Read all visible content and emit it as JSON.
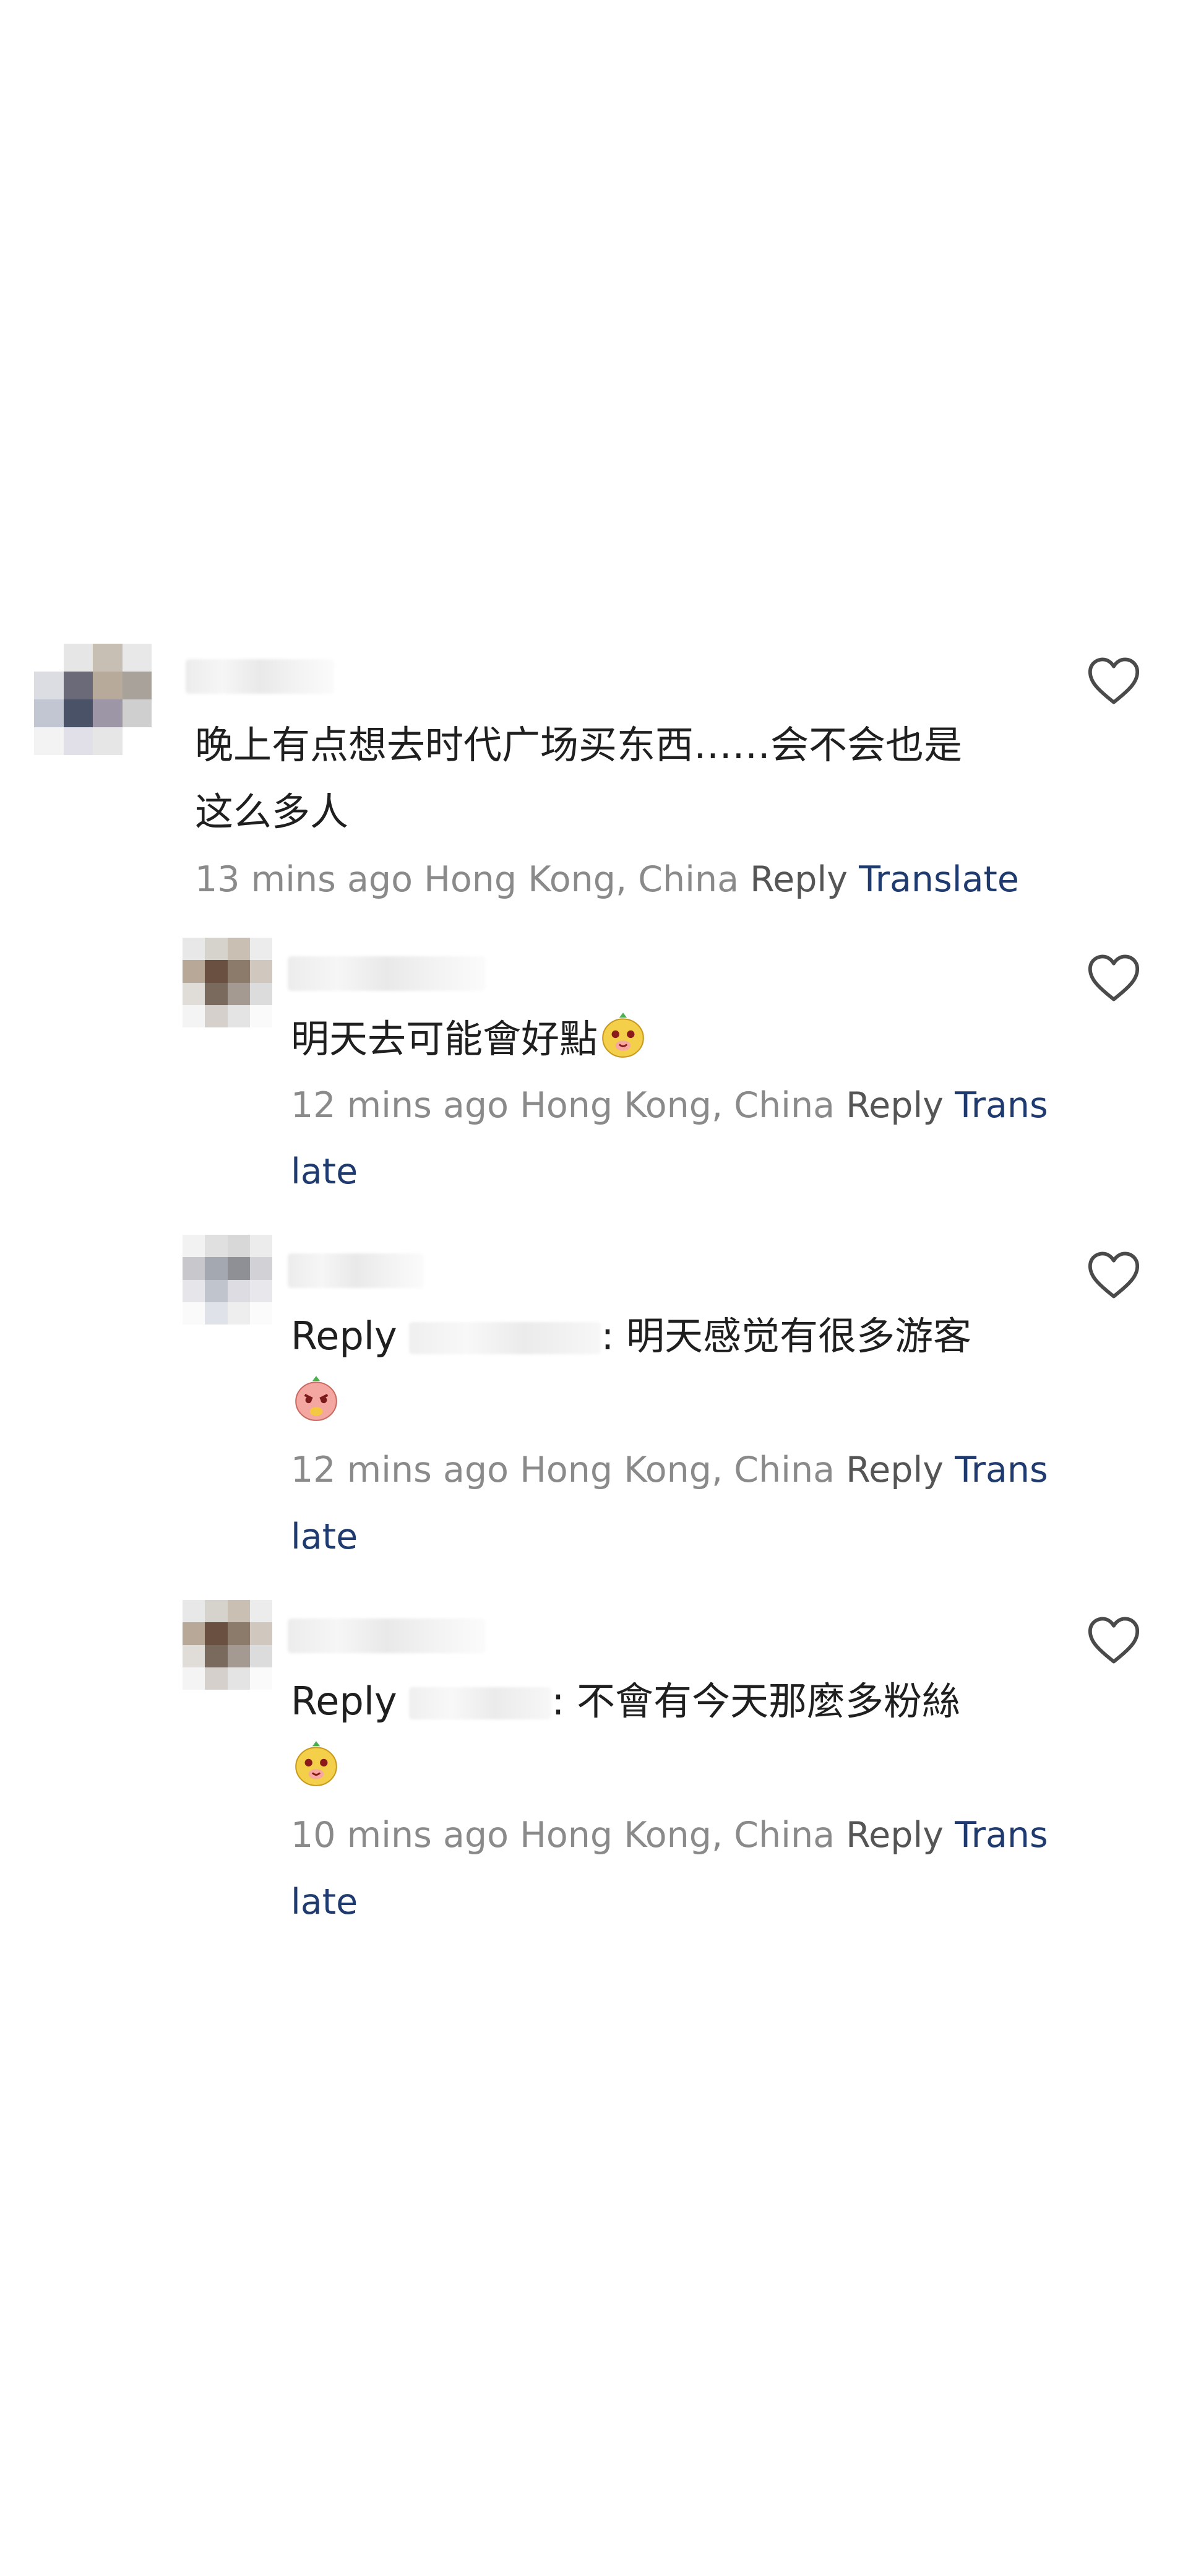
{
  "comments": [
    {
      "text_line1": "晚上有点想去时代广场买东西……会不会也是",
      "text_line2": "这么多人",
      "time": "13 mins ago",
      "location": "Hong Kong, China",
      "reply_label": "Reply",
      "translate_label": "Translate"
    },
    {
      "text": "明天去可能會好點",
      "emoji": "yellow-mascot-emoji",
      "time": "12 mins ago",
      "location": "Hong Kong, China",
      "reply_label": "Reply",
      "translate_part1": "Trans",
      "translate_part2": "late"
    },
    {
      "reply_prefix": "Reply",
      "text": ": 明天感觉有很多游客",
      "emoji": "pink-mascot-emoji",
      "time": "12 mins ago",
      "location": "Hong Kong, China",
      "reply_label": "Reply",
      "translate_part1": "Trans",
      "translate_part2": "late"
    },
    {
      "reply_prefix": "Reply",
      "text": ": 不會有今天那麼多粉絲",
      "emoji": "yellow-mascot-emoji",
      "time": "10 mins ago",
      "location": "Hong Kong, China",
      "reply_label": "Reply",
      "translate_part1": "Trans",
      "translate_part2": "late"
    }
  ],
  "icons": {
    "like": "heart-outline-icon"
  },
  "colors": {
    "text": "#1f1f1f",
    "meta": "#8a8a8a",
    "reply": "#555555",
    "translate": "#1f3a6e",
    "heart": "#4a4a4a"
  }
}
